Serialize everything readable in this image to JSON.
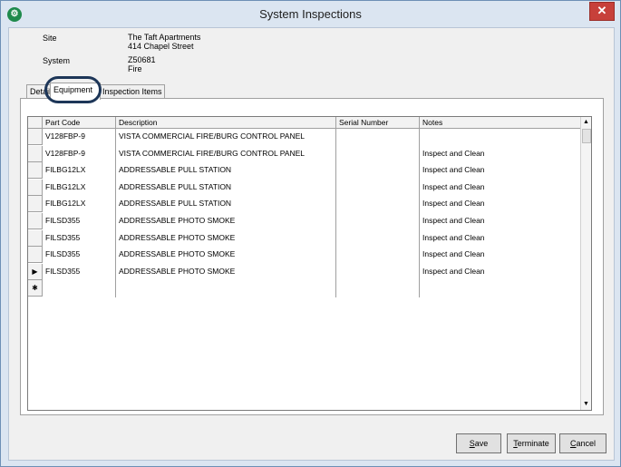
{
  "window": {
    "title": "System Inspections",
    "close_glyph": "✕"
  },
  "info": {
    "site_label": "Site",
    "site_name": "The Taft Apartments",
    "site_address": "414 Chapel Street",
    "system_label": "System",
    "system_id": "Z50681",
    "system_type": "Fire"
  },
  "tabs": [
    {
      "label": "Detail"
    },
    {
      "label": "Equipment"
    },
    {
      "label": "Inspection Items"
    }
  ],
  "grid": {
    "columns": [
      "Part Code",
      "Description",
      "Serial Number",
      "Notes"
    ],
    "rows": [
      {
        "part_code": "V128FBP-9",
        "description": "VISTA COMMERCIAL FIRE/BURG CONTROL PANEL",
        "serial": "",
        "notes": ""
      },
      {
        "part_code": "V128FBP-9",
        "description": "VISTA COMMERCIAL FIRE/BURG CONTROL PANEL",
        "serial": "",
        "notes": "Inspect and Clean"
      },
      {
        "part_code": "FILBG12LX",
        "description": "ADDRESSABLE PULL STATION",
        "serial": "",
        "notes": "Inspect and Clean"
      },
      {
        "part_code": "FILBG12LX",
        "description": "ADDRESSABLE PULL STATION",
        "serial": "",
        "notes": "Inspect and Clean"
      },
      {
        "part_code": "FILBG12LX",
        "description": "ADDRESSABLE PULL STATION",
        "serial": "",
        "notes": "Inspect and Clean"
      },
      {
        "part_code": "FILSD355",
        "description": "ADDRESSABLE PHOTO SMOKE",
        "serial": "",
        "notes": "Inspect and Clean"
      },
      {
        "part_code": "FILSD355",
        "description": "ADDRESSABLE PHOTO SMOKE",
        "serial": "",
        "notes": "Inspect and Clean"
      },
      {
        "part_code": "FILSD355",
        "description": "ADDRESSABLE PHOTO SMOKE",
        "serial": "",
        "notes": "Inspect and Clean"
      },
      {
        "part_code": "FILSD355",
        "description": "ADDRESSABLE PHOTO SMOKE",
        "serial": "",
        "notes": "Inspect and Clean"
      }
    ],
    "current_row_glyph": "▶",
    "new_row_glyph": "✱"
  },
  "buttons": {
    "save_access": "S",
    "save_rest": "ave",
    "terminate_access": "T",
    "terminate_rest": "erminate",
    "cancel_access": "C",
    "cancel_rest": "ancel"
  },
  "colors": {
    "highlight_ring": "#1d3658",
    "close_button": "#c7403a"
  }
}
